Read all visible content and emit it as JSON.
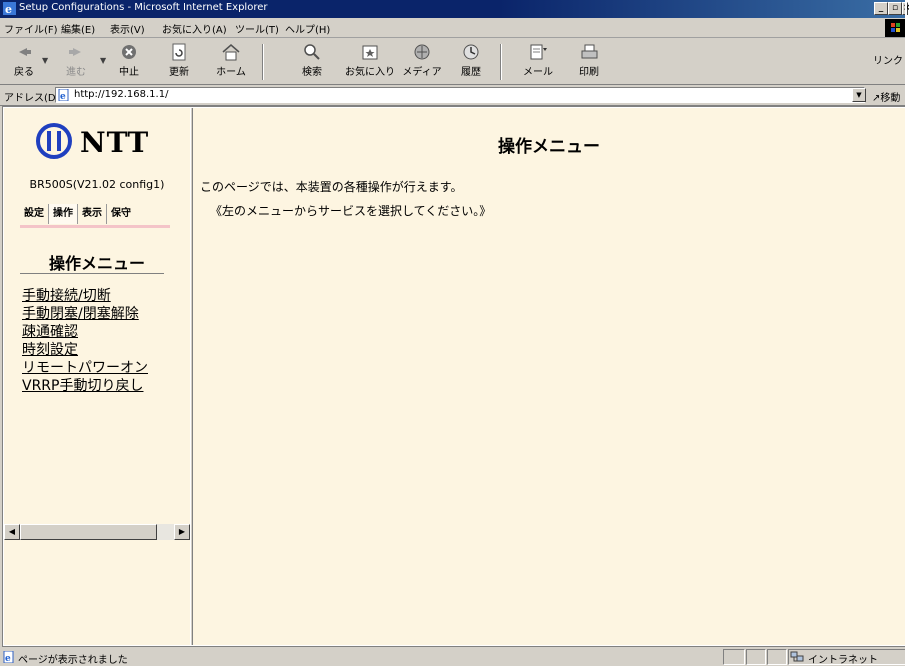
{
  "window": {
    "title": "Setup Configurations - Microsoft Internet Explorer",
    "min_icon": "minimize-icon",
    "max_icon": "maximize-icon",
    "close_icon": "close-icon"
  },
  "menubar": {
    "items": [
      "ファイル(F)",
      "編集(E)",
      "表示(V)",
      "お気に入り(A)",
      "ツール(T)",
      "ヘルプ(H)"
    ]
  },
  "toolbar": {
    "back": "戻る",
    "forward": "進む",
    "stop": "中止",
    "refresh": "更新",
    "home": "ホーム",
    "search": "検索",
    "favorites": "お気に入り",
    "media": "メディア",
    "history": "履歴",
    "mail": "メール",
    "print": "印刷",
    "links": "リンク"
  },
  "address": {
    "label": "アドレス(D)",
    "url": "http://192.168.1.1/",
    "go": "移動"
  },
  "sidebar": {
    "logo_text": "NTT",
    "model": "BR500S(V21.02 config1)",
    "tabs": [
      "設定",
      "操作",
      "表示",
      "保守"
    ],
    "active_tab": "操作",
    "heading": "操作メニュー",
    "links": [
      "手動接続/切断",
      "手動閉塞/閉塞解除",
      "疎通確認",
      "時刻設定",
      "リモートパワーオン",
      "VRRP手動切り戻し"
    ]
  },
  "main": {
    "title": "操作メニュー",
    "description": "このページでは、本装置の各種操作が行えます。",
    "note": "《左のメニューからサービスを選択してください。》"
  },
  "statusbar": {
    "text": "ページが表示されました",
    "zone": "イントラネット"
  },
  "colors": {
    "titlebar": "#0a246a",
    "chrome": "#d4d0c8",
    "page_background": "#fdf5e1",
    "tab_underline": "#f4c4c8"
  }
}
